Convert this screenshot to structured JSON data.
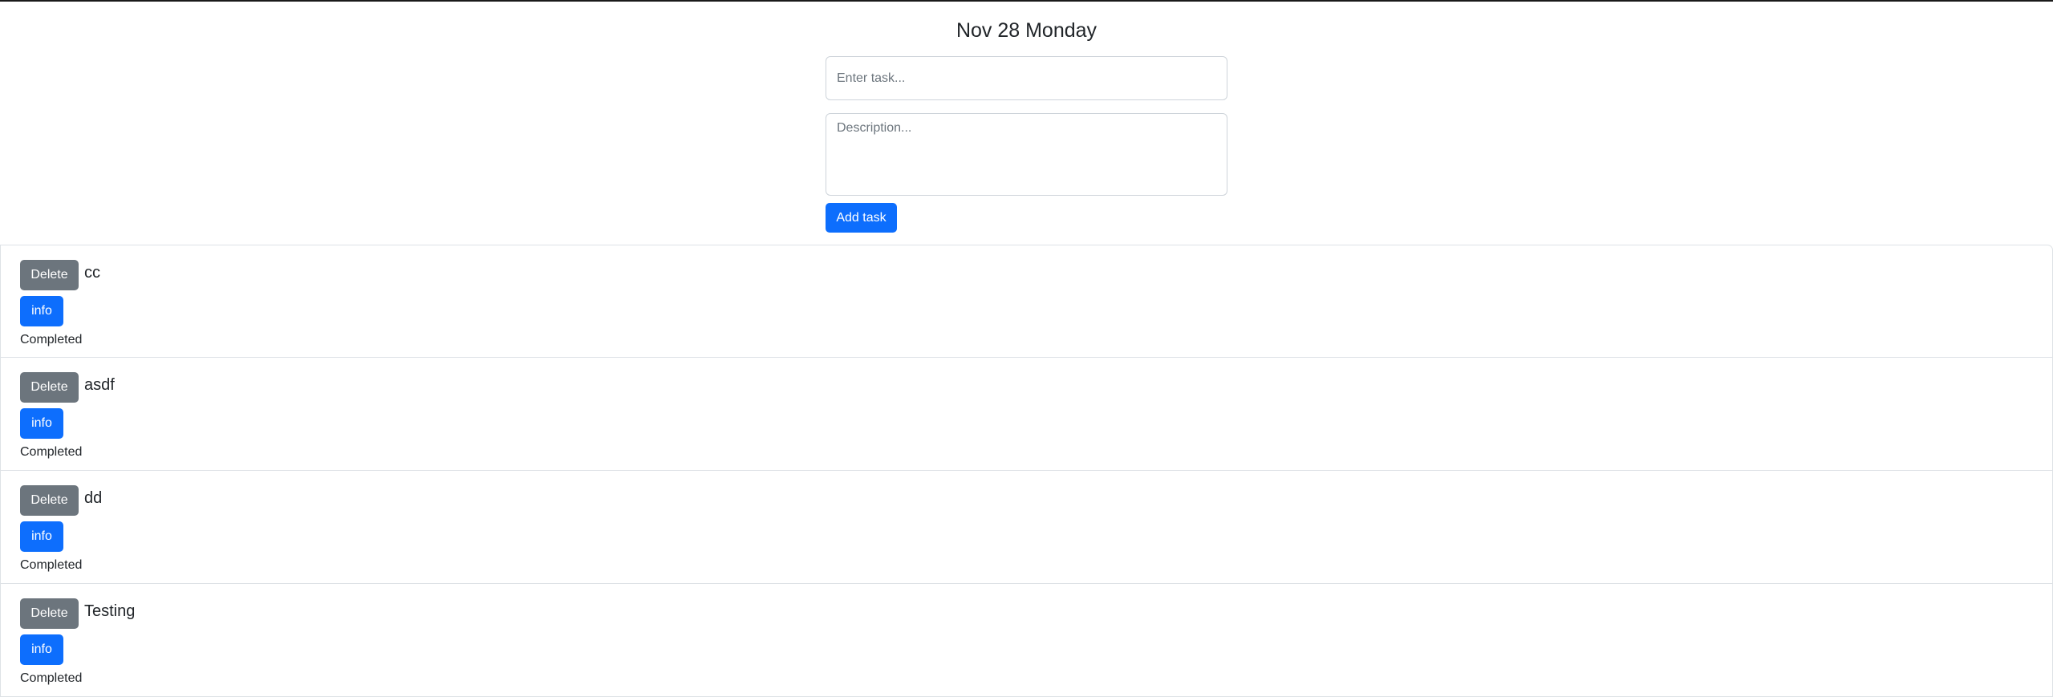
{
  "header": {
    "date_title": "Nov 28 Monday"
  },
  "form": {
    "task_placeholder": "Enter task...",
    "task_value": "",
    "description_placeholder": "Description...",
    "description_value": "",
    "add_label": "Add task"
  },
  "tasks": [
    {
      "name": "cc",
      "delete_label": "Delete",
      "info_label": "info",
      "status": "Completed"
    },
    {
      "name": "asdf",
      "delete_label": "Delete",
      "info_label": "info",
      "status": "Completed"
    },
    {
      "name": "dd",
      "delete_label": "Delete",
      "info_label": "info",
      "status": "Completed"
    },
    {
      "name": "Testing",
      "delete_label": "Delete",
      "info_label": "info",
      "status": "Completed"
    }
  ],
  "colors": {
    "primary": "#0d6efd",
    "secondary": "#6c757d",
    "border": "#dee2e6"
  }
}
